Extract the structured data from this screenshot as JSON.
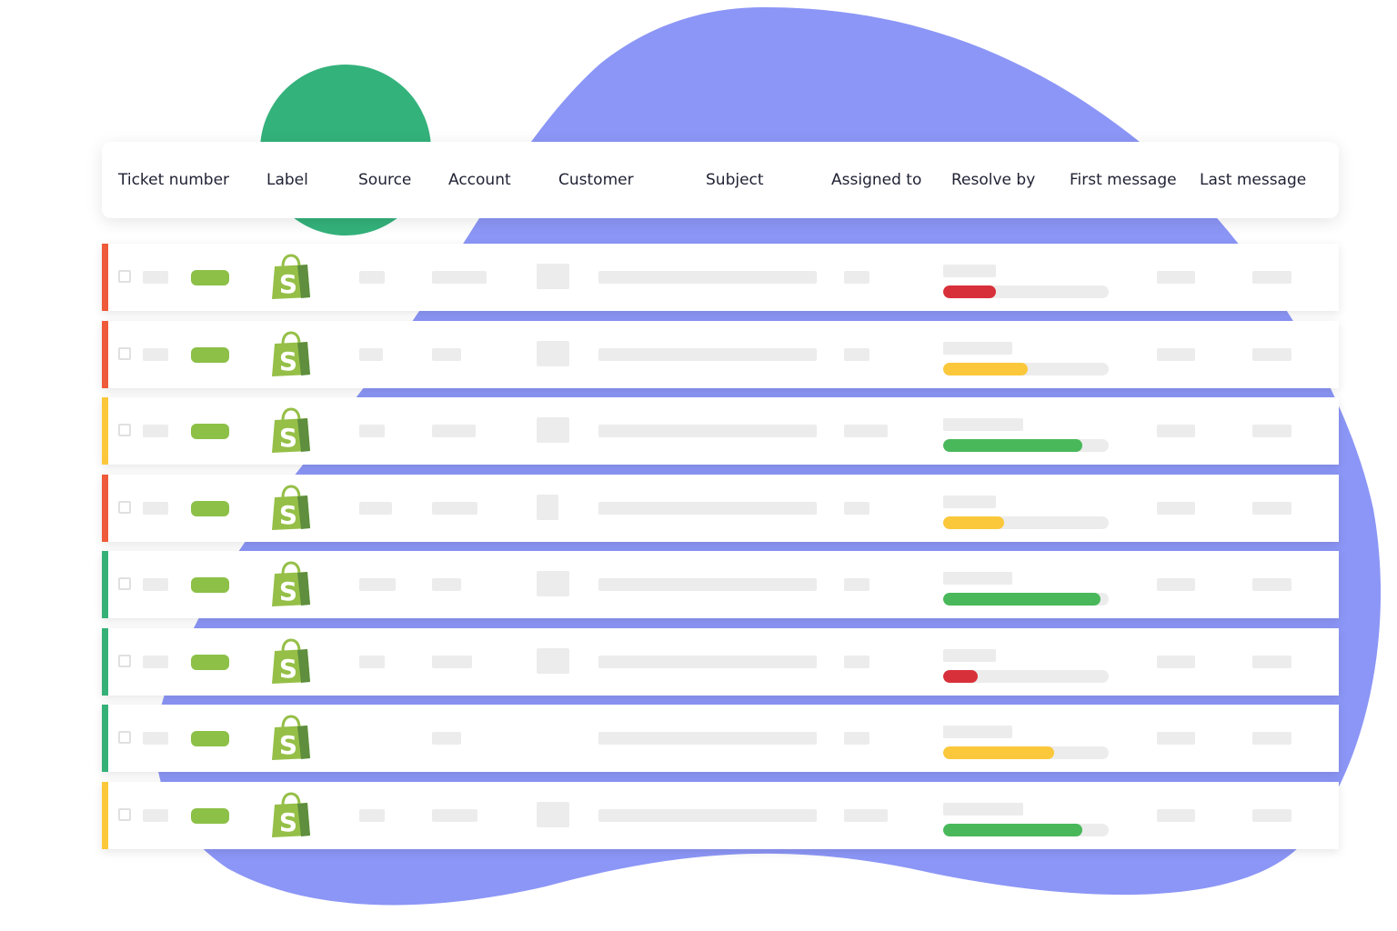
{
  "colors": {
    "blob": "#8c96f6",
    "green_circle": "#34b27b",
    "label_pill": "#8cc047",
    "shopify_bag": "#95bf47",
    "priority_red": "#ef5a3a",
    "priority_yellow": "#fbc83c",
    "priority_green": "#35b178",
    "progress_red": "#d8303a",
    "progress_yellow": "#fbc83c",
    "progress_green": "#49b85a"
  },
  "header": {
    "columns": [
      {
        "key": "ticket",
        "label": "Ticket number"
      },
      {
        "key": "label",
        "label": "Label"
      },
      {
        "key": "source",
        "label": "Source"
      },
      {
        "key": "account",
        "label": "Account"
      },
      {
        "key": "customer",
        "label": "Customer"
      },
      {
        "key": "subject",
        "label": "Subject"
      },
      {
        "key": "assigned",
        "label": "Assigned to"
      },
      {
        "key": "resolve",
        "label": "Resolve by"
      },
      {
        "key": "first",
        "label": "First message"
      },
      {
        "key": "last",
        "label": "Last message"
      }
    ]
  },
  "icons": {
    "source": "shopify-bag-icon",
    "source_letter": "S"
  },
  "tickets": [
    {
      "priority": "red",
      "resolve_progress": 0.32,
      "resolve_status": "red"
    },
    {
      "priority": "red",
      "resolve_progress": 0.51,
      "resolve_status": "yellow"
    },
    {
      "priority": "yellow",
      "resolve_progress": 0.84,
      "resolve_status": "green"
    },
    {
      "priority": "red",
      "resolve_progress": 0.37,
      "resolve_status": "yellow"
    },
    {
      "priority": "green",
      "resolve_progress": 0.95,
      "resolve_status": "green"
    },
    {
      "priority": "green",
      "resolve_progress": 0.21,
      "resolve_status": "red"
    },
    {
      "priority": "green",
      "resolve_progress": 0.67,
      "resolve_status": "yellow"
    },
    {
      "priority": "yellow",
      "resolve_progress": 0.84,
      "resolve_status": "green"
    }
  ]
}
